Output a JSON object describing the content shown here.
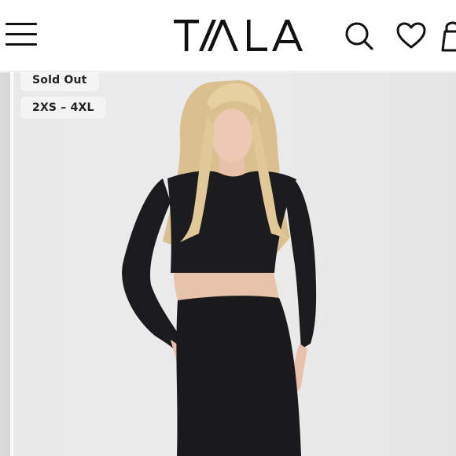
{
  "header": {
    "brand": "TALA",
    "icons": [
      "menu-icon",
      "search-icon",
      "heart-icon",
      "bag-icon"
    ]
  },
  "product": {
    "status_badge": "Sold Out",
    "size_range_badge": "2XS – 4XL",
    "image_alt": "Model wearing black long sleeve crop top and black midi skirt"
  },
  "colors": {
    "text": "#111111",
    "badge_bg": "#f4f4f4",
    "photo_bg": "#e9e9ea"
  }
}
